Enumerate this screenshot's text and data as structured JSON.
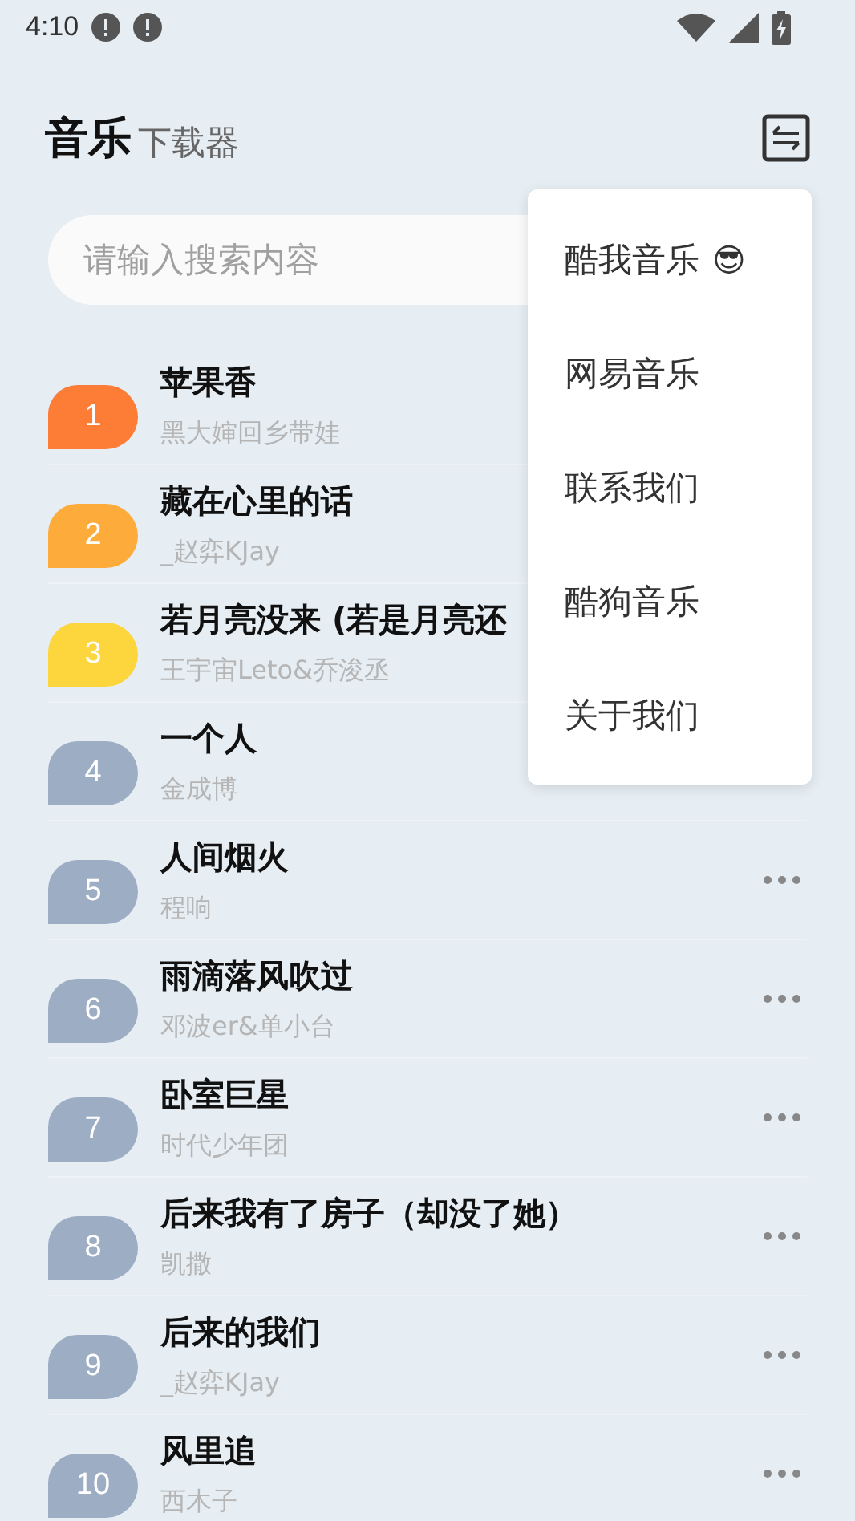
{
  "status_bar": {
    "time": "4:10",
    "notifications": [
      {
        "kind": "alert"
      },
      {
        "kind": "alert"
      }
    ]
  },
  "header": {
    "title": "音乐",
    "subtitle": "下载器"
  },
  "search": {
    "placeholder": "请输入搜索内容"
  },
  "songs": [
    {
      "rank": "1",
      "title": "苹果香",
      "artist": "黑大婶回乡带娃",
      "color": "#fd7d36",
      "more_button": false
    },
    {
      "rank": "2",
      "title": "藏在心里的话",
      "artist": "_赵弈KJay",
      "color": "#fdac3c",
      "more_button": false
    },
    {
      "rank": "3",
      "title": "若月亮没来 (若是月亮还",
      "artist": "王宇宙Leto&乔浚丞",
      "color": "#fdd53c",
      "more_button": false
    },
    {
      "rank": "4",
      "title": "一个人",
      "artist": "金成博",
      "color": "#9dadc4",
      "more_button": false
    },
    {
      "rank": "5",
      "title": "人间烟火",
      "artist": "程响",
      "color": "#9dadc4",
      "more_button": true
    },
    {
      "rank": "6",
      "title": "雨滴落风吹过",
      "artist": "邓波er&单小台",
      "color": "#9dadc4",
      "more_button": true
    },
    {
      "rank": "7",
      "title": "卧室巨星",
      "artist": "时代少年团",
      "color": "#9dadc4",
      "more_button": true
    },
    {
      "rank": "8",
      "title": "后来我有了房子（却没了她）",
      "artist": "凯撒",
      "color": "#9dadc4",
      "more_button": true
    },
    {
      "rank": "9",
      "title": "后来的我们",
      "artist": "_赵弈KJay",
      "color": "#9dadc4",
      "more_button": true
    },
    {
      "rank": "10",
      "title": "风里追",
      "artist": "西木子",
      "color": "#9dadc4",
      "more_button": true
    }
  ],
  "menu": {
    "items": [
      {
        "label": "酷我音乐",
        "emoji": "😎"
      },
      {
        "label": "网易音乐"
      },
      {
        "label": "联系我们"
      },
      {
        "label": "酷狗音乐"
      },
      {
        "label": "关于我们"
      }
    ]
  }
}
